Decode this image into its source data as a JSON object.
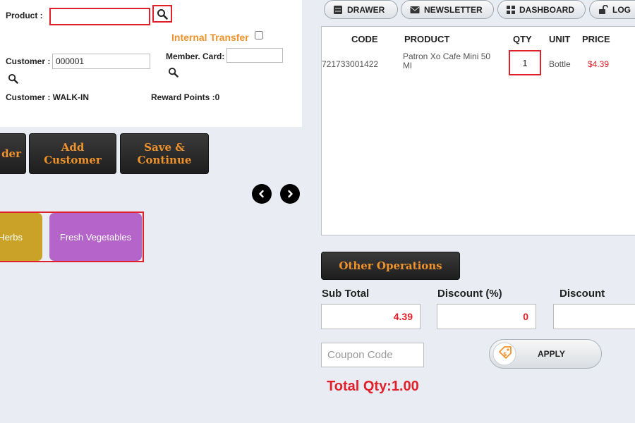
{
  "left": {
    "product_label": "Product :",
    "product_value": "",
    "internal_transfer_label": "Internal Transfer",
    "internal_transfer_checked": false,
    "customer_label": "Customer :",
    "customer_value": "000001",
    "member_card_label": "Member. Card:",
    "member_card_value": "",
    "customer_name_label": "Customer : WALK-IN",
    "reward_points_label": "Reward Points :0"
  },
  "actions": {
    "order_label": "der",
    "add_customer_line1": "Add",
    "add_customer_line2": "Customer",
    "save_line1": "Save &",
    "save_line2": "Continue"
  },
  "categories": [
    {
      "label": "Herbs",
      "color": "#c9a227"
    },
    {
      "label": "Fresh Vegetables",
      "color": "#b565c9"
    }
  ],
  "nav": {
    "drawer": "DRAWER",
    "newsletter": "NEWSLETTER",
    "dashboard": "DASHBOARD",
    "log": "LOG"
  },
  "cart": {
    "headers": {
      "code": "CODE",
      "product": "PRODUCT",
      "qty": "QTY",
      "unit": "UNIT",
      "price": "PRICE"
    },
    "rows": [
      {
        "code": "721733001422",
        "product": "Patron Xo Cafe Mini 50 Ml",
        "qty": "1",
        "unit": "Bottle",
        "price": "$4.39"
      }
    ]
  },
  "totals": {
    "other_operations": "Other Operations",
    "sub_total_label": "Sub Total",
    "sub_total_value": "4.39",
    "discount_pct_label": "Discount (%)",
    "discount_pct_value": "0",
    "discount_label": "Discount",
    "discount_value": "",
    "coupon_placeholder": "Coupon Code",
    "apply_label": "APPLY",
    "total_qty": "Total Qty:1.00"
  },
  "colors": {
    "accent_orange": "#f0922c",
    "alert_red": "#e0202a"
  }
}
